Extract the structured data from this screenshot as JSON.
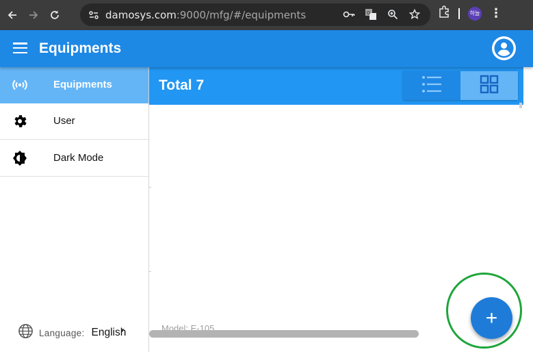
{
  "browser": {
    "url_host": "damosys.com",
    "url_rest": ":9000/mfg/#/equipments",
    "profile_initials": "하늘"
  },
  "appbar": {
    "title": "Equipments",
    "color": "#1e88e5"
  },
  "sidebar": {
    "items": [
      {
        "label": "Equipments",
        "icon": "broadcast-icon",
        "active": true
      },
      {
        "label": "User",
        "icon": "gear-icon",
        "active": false
      },
      {
        "label": "Dark Mode",
        "icon": "brightness-icon",
        "active": false
      }
    ],
    "language_label": "Language:",
    "language_value": "English"
  },
  "main": {
    "total_label": "Total 7",
    "header_color": "#2196f3",
    "view_toggle": [
      {
        "icon": "list-view-icon",
        "selected": false
      },
      {
        "icon": "grid-view-icon",
        "selected": true
      }
    ],
    "partial_text": "Model: E-105"
  },
  "fab": {
    "label": "+",
    "highlight_color": "#1ea53a"
  }
}
